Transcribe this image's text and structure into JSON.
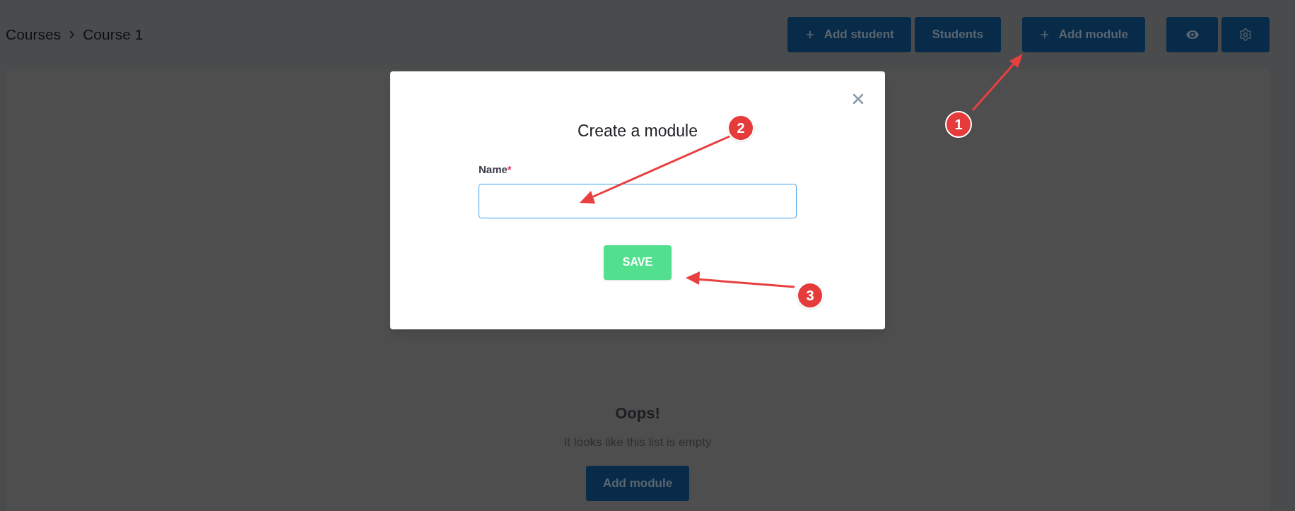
{
  "breadcrumb": [
    "Courses",
    "Course 1"
  ],
  "toolbar": [
    {
      "kind": "text",
      "label": "Add student",
      "plus": true
    },
    {
      "kind": "text",
      "label": "Students",
      "plus": false
    },
    {
      "kind": "text",
      "label": "Add module",
      "plus": true
    },
    {
      "kind": "eye"
    },
    {
      "kind": "gear"
    }
  ],
  "empty_state": {
    "title": "Oops!",
    "message": "It looks like this list is empty",
    "button": "Add module"
  },
  "modal": {
    "title": "Create a module",
    "field_label": "Name",
    "required_mark": "*",
    "button": "SAVE"
  },
  "annotations": [
    "1",
    "2",
    "3"
  ]
}
